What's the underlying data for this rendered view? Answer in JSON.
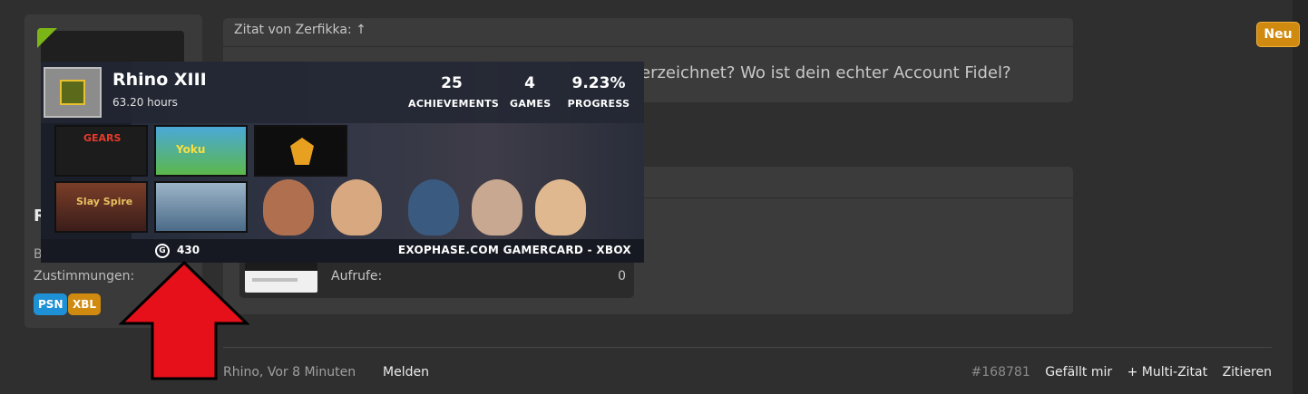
{
  "user": {
    "initial": "R",
    "line_b": "B",
    "zustimmungen_label": "Zustimmungen:",
    "badges": [
      "PSN",
      "XBL"
    ]
  },
  "quote": {
    "header": "Zitat von Zerfikka: ↑",
    "text": "erzeichnet? Wo ist dein echter Account Fidel?"
  },
  "attachment": {
    "views_label": "Aufrufe:",
    "views_value": "0"
  },
  "footer": {
    "author": "Rhino, Vor 8 Minuten",
    "report": "Melden",
    "post_number": "#168781",
    "like": "Gefällt mir",
    "multiquote": "+ Multi-Zitat",
    "quote": "Zitieren"
  },
  "new_badge": "Neu",
  "gamercard": {
    "name": "Rhino XIII",
    "hours": "63.20 hours",
    "achievements_value": "25",
    "achievements_label": "ACHIEVEMENTS",
    "games_value": "4",
    "games_label": "GAMES",
    "progress_value": "9.23%",
    "progress_label": "PROGRESS",
    "gamerscore_icon": "G",
    "gamerscore": "430",
    "footer": "EXOPHASE.COM GAMERCARD - XBOX",
    "tiles": [
      "GEARS",
      "Yoku",
      "",
      "Slay Spire",
      ""
    ]
  },
  "colors": {
    "arrow": "#e5101a",
    "accent_orange": "#d08a10",
    "psn_blue": "#1e90d6",
    "online_green": "#7cb518"
  }
}
